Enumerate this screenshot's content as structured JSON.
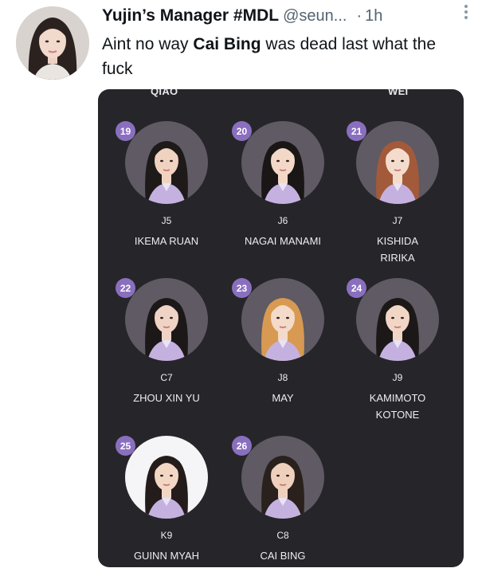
{
  "tweet": {
    "display_name": "Yujin’s Manager #MDL",
    "handle": "@seun...",
    "separator": "·",
    "time": "1h",
    "text_before": "Aint no way ",
    "text_bold": "Cai Bing",
    "text_after": " was dead last what the fuck"
  },
  "media": {
    "top_left_label": "QIAO",
    "top_right_label": "WEI",
    "trainees": [
      {
        "rank": "19",
        "code": "J5",
        "name": "IKEMA RUAN",
        "hair": "#1e1a1a",
        "skin": "#f0d2c0"
      },
      {
        "rank": "20",
        "code": "J6",
        "name": "NAGAI MANAMI",
        "hair": "#1a1616",
        "skin": "#f3d8c7"
      },
      {
        "rank": "21",
        "code": "J7",
        "name": "KISHIDA RIRIKA",
        "hair": "#a35a3a",
        "skin": "#f4dccc"
      },
      {
        "rank": "22",
        "code": "C7",
        "name": "ZHOU XIN YU",
        "hair": "#1c1818",
        "skin": "#efd3c4"
      },
      {
        "rank": "23",
        "code": "J8",
        "name": "MAY",
        "hair": "#d89a52",
        "skin": "#f4dac8"
      },
      {
        "rank": "24",
        "code": "J9",
        "name": "KAMIMOTO KOTONE",
        "hair": "#1c1818",
        "skin": "#f1d6c6"
      },
      {
        "rank": "25",
        "code": "K9",
        "name": "GUINN MYAH",
        "hair": "#241c1a",
        "skin": "#f3d7c5"
      },
      {
        "rank": "26",
        "code": "C8",
        "name": "CAI BING",
        "hair": "#2a201c",
        "skin": "#efd0bd"
      }
    ]
  },
  "colors": {
    "badge": "#8a6fbf",
    "card_bg": "#26262a",
    "uniform": "#c5b1e0"
  }
}
